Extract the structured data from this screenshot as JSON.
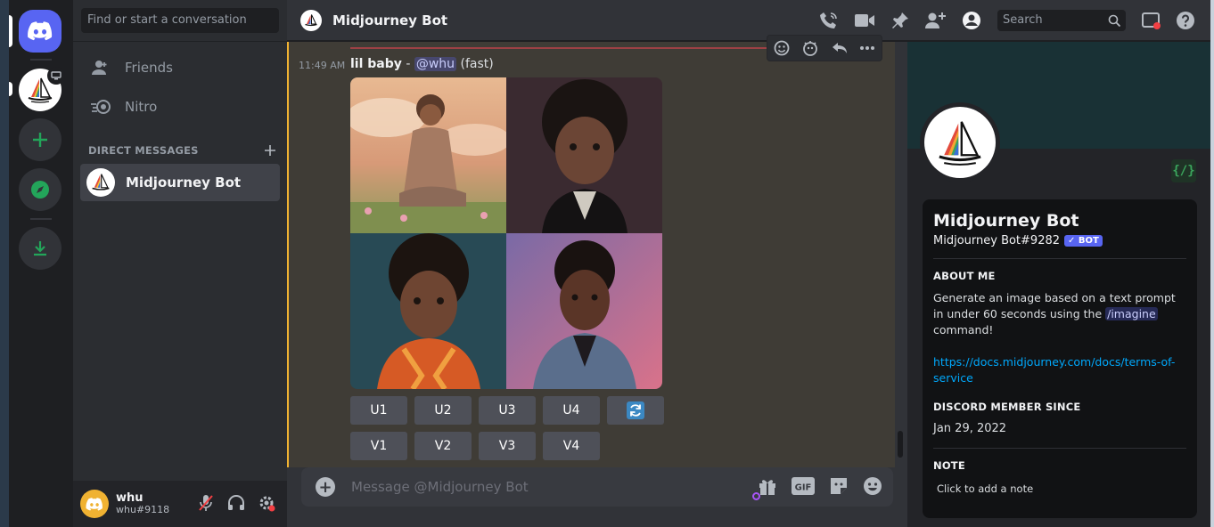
{
  "sidebar": {
    "search_placeholder": "Find or start a conversation",
    "nav": [
      {
        "label": "Friends",
        "icon": "friends-icon"
      },
      {
        "label": "Nitro",
        "icon": "nitro-icon"
      }
    ],
    "dm_header": "DIRECT MESSAGES",
    "dm_item": "Midjourney Bot",
    "user": {
      "name": "whu",
      "tag": "whu#9118"
    }
  },
  "topbar": {
    "title": "Midjourney Bot",
    "search_placeholder": "Search"
  },
  "message": {
    "time": "11:49 AM",
    "prompt": "lil baby",
    "separator": " - ",
    "mention": "@whu",
    "mode": "(fast)",
    "upscale_buttons": [
      "U1",
      "U2",
      "U3",
      "U4"
    ],
    "variation_buttons": [
      "V1",
      "V2",
      "V3",
      "V4"
    ]
  },
  "composer": {
    "placeholder": "Message @Midjourney Bot"
  },
  "profile": {
    "name": "Midjourney Bot",
    "tag": "Midjourney Bot#9282",
    "bot_badge": "✓ BOT",
    "dev_badge": "{/}",
    "about_header": "ABOUT ME",
    "about_text_1": "Generate an image based on a text prompt in under 60 seconds using the ",
    "about_cmd": "/imagine",
    "about_text_2": " command!",
    "link": "https://docs.midjourney.com/docs/terms-of-service",
    "since_header": "DISCORD MEMBER SINCE",
    "since_value": "Jan 29, 2022",
    "note_header": "NOTE",
    "note_placeholder": "Click to add a note"
  },
  "colors": {
    "blurple": "#5865f2",
    "highlight": "#f0b232",
    "link": "#00a8fc"
  }
}
